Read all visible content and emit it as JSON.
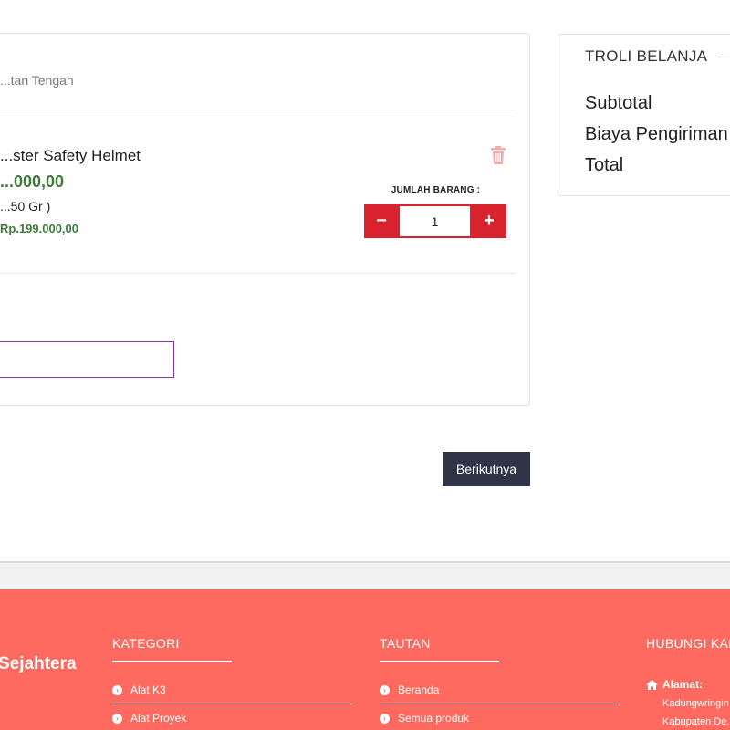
{
  "cart": {
    "store_location": "...tan Tengah",
    "product": {
      "name": "...ster Safety Helmet",
      "price": "...000,00",
      "weight": "...50 Gr )",
      "subtotal": "Rp.199.000,00"
    },
    "quantity_label": "JUMLAH BARANG :",
    "quantity_value": "1",
    "decrement_label": "−",
    "increment_label": "+",
    "next_button": "Berikutnya"
  },
  "summary": {
    "title": "TROLI BELANJA",
    "rows": [
      "Subtotal",
      "Biaya Pengiriman",
      "Total"
    ]
  },
  "footer": {
    "brand": "Sejahtera",
    "kategori": {
      "heading": "KATEGORI",
      "links": [
        "Alat K3",
        "Alat Proyek"
      ]
    },
    "tautan": {
      "heading": "TAUTAN",
      "links": [
        "Beranda",
        "Semua produk"
      ]
    },
    "hubungi": {
      "heading": "HUBUNGI KAMI",
      "address_label": "Alamat:",
      "address_lines": [
        "Kadungwringin",
        "Kabupaten De..."
      ]
    }
  },
  "colors": {
    "accent_red": "#d8232f",
    "price_green": "#3f7a3a",
    "footer_bg": "#fe6a5f",
    "button_dark": "#2f3446",
    "note_border": "#8a33b8"
  }
}
